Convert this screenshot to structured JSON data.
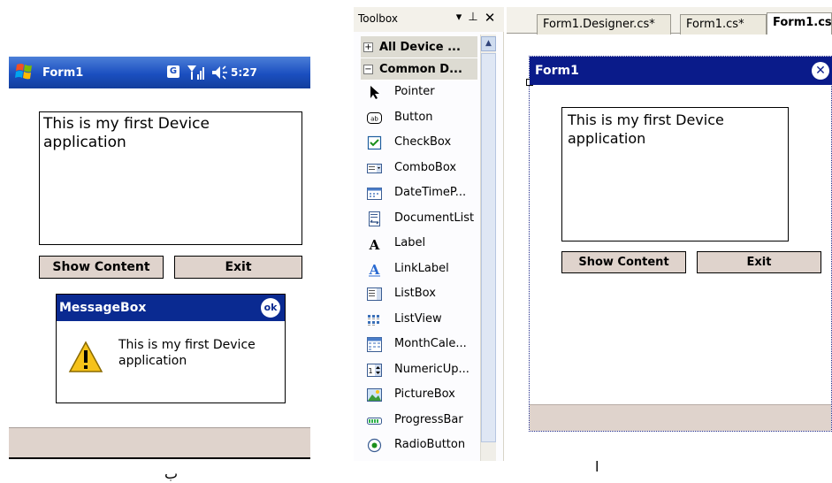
{
  "device": {
    "title": "Form1",
    "status_g": "G",
    "time": "5:27",
    "textbox_text": "This is my first Device\napplication",
    "show_button": "Show Content",
    "exit_button": "Exit",
    "messagebox": {
      "title": "MessageBox",
      "ok_label": "ok",
      "text": "This is my first Device application"
    }
  },
  "captions": {
    "left": "ب",
    "right": "أ"
  },
  "toolbox": {
    "title": "Toolbox",
    "groups": [
      {
        "sign": "+",
        "label": "All Device ..."
      },
      {
        "sign": "−",
        "label": "Common D..."
      }
    ],
    "items": [
      {
        "label": "Pointer",
        "icon": "pointer-icon"
      },
      {
        "label": "Button",
        "icon": "button-icon"
      },
      {
        "label": "CheckBox",
        "icon": "checkbox-icon"
      },
      {
        "label": "ComboBox",
        "icon": "combobox-icon"
      },
      {
        "label": "DateTimeP...",
        "icon": "datetimepicker-icon"
      },
      {
        "label": "DocumentList",
        "icon": "documentlist-icon"
      },
      {
        "label": "Label",
        "icon": "label-icon"
      },
      {
        "label": "LinkLabel",
        "icon": "linklabel-icon"
      },
      {
        "label": "ListBox",
        "icon": "listbox-icon"
      },
      {
        "label": "ListView",
        "icon": "listview-icon"
      },
      {
        "label": "MonthCale...",
        "icon": "monthcalendar-icon"
      },
      {
        "label": "NumericUp...",
        "icon": "numericupdown-icon"
      },
      {
        "label": "PictureBox",
        "icon": "picturebox-icon"
      },
      {
        "label": "ProgressBar",
        "icon": "progressbar-icon"
      },
      {
        "label": "RadioButton",
        "icon": "radiobutton-icon"
      }
    ]
  },
  "designer": {
    "tabs": [
      "Form1.Designer.cs*",
      "Form1.cs*",
      "Form1.cs"
    ],
    "form_title": "Form1",
    "textbox_text": "This is my first Device\napplication",
    "show_button": "Show Content",
    "exit_button": "Exit"
  },
  "colors": {
    "device_titlebar": "#1b4fc0",
    "messagebox_titlebar": "#0a2a91",
    "designer_titlebar": "#0a1b8a",
    "button_face": "#dfd3cc"
  }
}
